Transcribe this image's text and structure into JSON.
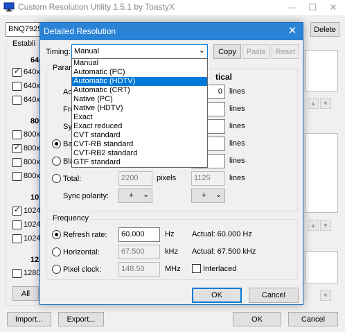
{
  "app": {
    "title": "Custom Resolution Utility 1.5.1 by ToastyX",
    "monitor_combo": "BNQ7925",
    "delete_label": "Delete",
    "established_label": "Establi",
    "import_label": "Import...",
    "export_label": "Export...",
    "ok_label": "OK",
    "cancel_label": "Cancel",
    "all_label": "All",
    "established_headers": [
      "640",
      "800",
      "102",
      "128"
    ],
    "established_rows": [
      {
        "text": "640x",
        "checked": true
      },
      {
        "text": "640x",
        "checked": false
      },
      {
        "text": "640x",
        "checked": false
      },
      {
        "text": "800x",
        "checked": false
      },
      {
        "text": "800x",
        "checked": true
      },
      {
        "text": "800x",
        "checked": false
      },
      {
        "text": "800x",
        "checked": false
      },
      {
        "text": "1024",
        "checked": true
      },
      {
        "text": "1024",
        "checked": false
      },
      {
        "text": "1024",
        "checked": false
      },
      {
        "text": "1280",
        "checked": false
      }
    ]
  },
  "dialog": {
    "title": "Detailed Resolution",
    "timing_label": "Timing:",
    "timing_value": "Manual",
    "copy_label": "Copy",
    "paste_label": "Paste",
    "reset_label": "Reset",
    "params_label": "Param",
    "vertical_label": "tical",
    "row_labels": [
      "Ac",
      "Fro",
      "Syn",
      "Bac",
      "Bla"
    ],
    "lines_unit": "lines",
    "vertical_active_value": "0",
    "total_label": "Total:",
    "total_h_value": "2200",
    "total_h_unit": "pixels",
    "total_v_value": "1125",
    "total_v_unit": "lines",
    "sync_polarity_label": "Sync polarity:",
    "sync_h": "+",
    "sync_v": "+",
    "frequency_label": "Frequency",
    "refresh_label": "Refresh rate:",
    "refresh_value": "60.000",
    "refresh_unit": "Hz",
    "refresh_actual": "Actual: 60.000 Hz",
    "horizontal_label": "Horizontal:",
    "horizontal_value": "67.500",
    "horizontal_unit": "kHz",
    "horizontal_actual": "Actual: 67.500 kHz",
    "pixel_clock_label": "Pixel clock:",
    "pixel_clock_value": "148.50",
    "pixel_clock_unit": "MHz",
    "interlaced_label": "Interlaced",
    "ok_label": "OK",
    "cancel_label": "Cancel",
    "timing_options": [
      "Manual",
      "Automatic (PC)",
      "Automatic (HDTV)",
      "Automatic (CRT)",
      "Native (PC)",
      "Native (HDTV)",
      "Exact",
      "Exact reduced",
      "CVT standard",
      "CVT-RB standard",
      "CVT-RB2 standard",
      "GTF standard"
    ],
    "timing_highlighted": "Automatic (HDTV)"
  },
  "colors": {
    "dialog_title_bg": "#2b83d6",
    "selection_bg": "#0078d7"
  }
}
